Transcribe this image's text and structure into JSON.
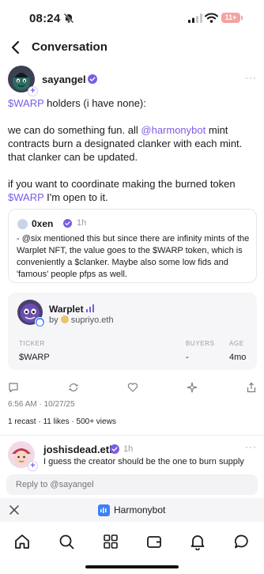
{
  "status_bar": {
    "time": "08:24",
    "battery": "11+"
  },
  "header": {
    "title": "Conversation"
  },
  "post": {
    "author": "sayangel",
    "line1_link": "$WARP",
    "line1_rest": " holders (i have none):",
    "para2_prefix": "we can do something fun. all ",
    "para2_mention": "@harmonybot",
    "para2_rest": " mint contracts burn a designated clanker with each mint. that clanker can be updated.",
    "para3_prefix": "if you want to coordinate making the burned token ",
    "para3_link": "$WARP",
    "para3_rest": " I'm open to it."
  },
  "quote": {
    "author": "0xen",
    "time": "1h",
    "text": "- @six mentioned this but since there are infinity mints of the Warplet NFT, the value goes to the $WARP token, which is conveniently a $clanker. Maybe also some low fids and 'famous' people pfps as well."
  },
  "token": {
    "name": "Warplet",
    "by_prefix": "by",
    "by_user": "supriyo.eth",
    "ticker_label": "TICKER",
    "ticker_value": "$WARP",
    "buyers_label": "BUYERS",
    "buyers_value": "-",
    "age_label": "AGE",
    "age_value": "4mo"
  },
  "meta": {
    "timestamp": "6:56 AM · 10/27/25",
    "stats": "1 recast · 11 likes · 500+ views"
  },
  "reply": {
    "author": "joshisdead.eth",
    "time": "1h",
    "text": "I guess the creator should be the one to burn supply",
    "input_placeholder": "Reply to @sayangel"
  },
  "mini_app": {
    "name": "Harmonybot"
  },
  "colors": {
    "accent": "#7c5ce6",
    "verified": "#7c5ce6",
    "harmonybot": "#3b82f6"
  },
  "icons": [
    "bell-off-icon",
    "signal-icon",
    "wifi-icon",
    "battery-icon",
    "back-icon",
    "verified-icon",
    "more-icon",
    "comment-icon",
    "recast-icon",
    "like-icon",
    "tip-icon",
    "share-icon",
    "close-icon",
    "home-icon",
    "search-icon",
    "grid-icon",
    "wallet-icon",
    "notifications-icon",
    "messages-icon"
  ]
}
